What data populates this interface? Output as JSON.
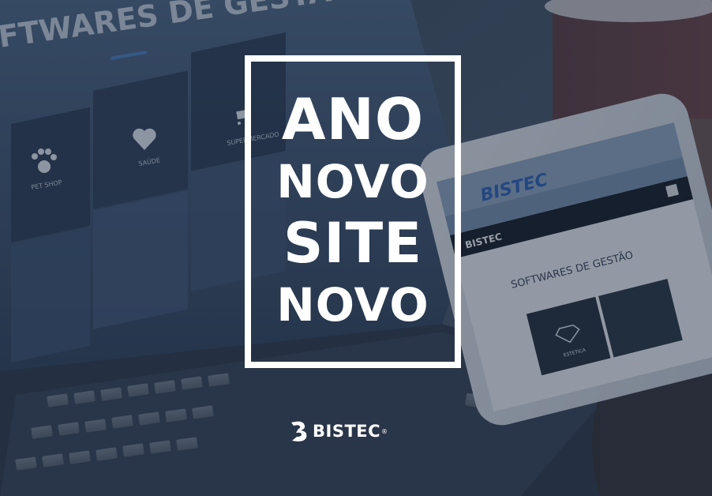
{
  "headline": {
    "line1": "ANO",
    "line2": "NOVO",
    "line3": "SITE",
    "line4": "NOVO"
  },
  "brand": {
    "name": "BISTEC",
    "registered": "®"
  },
  "laptop_screen": {
    "heading": "FTWARES DE GESTÃO",
    "tiles": [
      {
        "label": "PET SHOP",
        "icon": "paw-icon"
      },
      {
        "label": "SAÚDE",
        "icon": "heart-icon"
      },
      {
        "label": "SUPERMERCADO",
        "icon": "cart-icon"
      }
    ]
  },
  "phone_screen": {
    "banner_logo": "BISTEC",
    "nav_logo": "BISTEC",
    "heading": "SOFTWARES DE GESTÃO",
    "tile_label": "ESTETICA",
    "tile_icon": "diamond-icon"
  },
  "colors": {
    "overlay": "#1d2a3d",
    "text": "#ffffff",
    "brand_blue": "#2a5fb8"
  }
}
